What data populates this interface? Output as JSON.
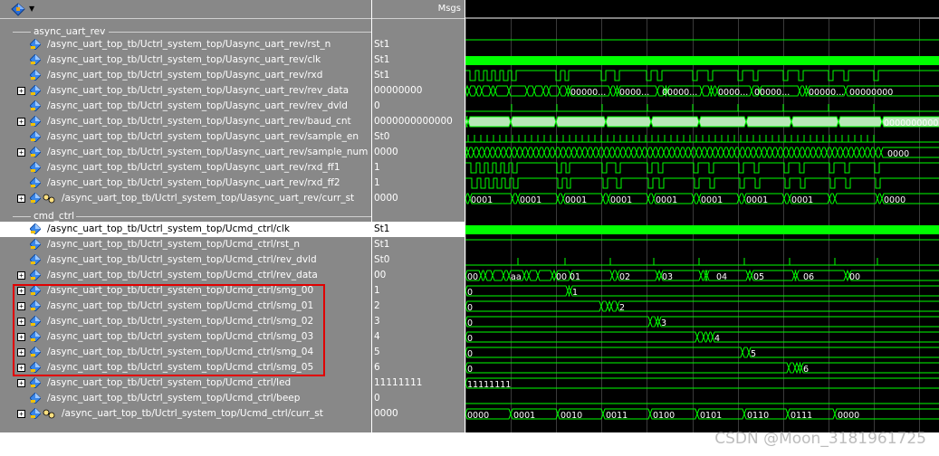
{
  "header": {
    "msgs_label": "Msgs"
  },
  "groups": [
    {
      "label": "async_uart_rev"
    },
    {
      "label": "cmd_ctrl"
    }
  ],
  "signals": [
    {
      "path": "/async_uart_top_tb/Uctrl_system_top/Uasync_uart_rev/rst_n",
      "value": "St1",
      "expand": false,
      "icon": "signal-icon"
    },
    {
      "path": "/async_uart_top_tb/Uctrl_system_top/Uasync_uart_rev/clk",
      "value": "St1",
      "expand": false,
      "icon": "signal-icon"
    },
    {
      "path": "/async_uart_top_tb/Uctrl_system_top/Uasync_uart_rev/rxd",
      "value": "St1",
      "expand": false,
      "icon": "signal-icon"
    },
    {
      "path": "/async_uart_top_tb/Uctrl_system_top/Uasync_uart_rev/rev_data",
      "value": "00000000",
      "expand": true,
      "icon": "signal-icon"
    },
    {
      "path": "/async_uart_top_tb/Uctrl_system_top/Uasync_uart_rev/rev_dvld",
      "value": "0",
      "expand": false,
      "icon": "signal-icon"
    },
    {
      "path": "/async_uart_top_tb/Uctrl_system_top/Uasync_uart_rev/baud_cnt",
      "value": "0000000000000",
      "expand": true,
      "icon": "signal-icon"
    },
    {
      "path": "/async_uart_top_tb/Uctrl_system_top/Uasync_uart_rev/sample_en",
      "value": "St0",
      "expand": false,
      "icon": "signal-icon"
    },
    {
      "path": "/async_uart_top_tb/Uctrl_system_top/Uasync_uart_rev/sample_num",
      "value": "0000",
      "expand": true,
      "icon": "signal-icon"
    },
    {
      "path": "/async_uart_top_tb/Uctrl_system_top/Uasync_uart_rev/rxd_ff1",
      "value": "1",
      "expand": false,
      "icon": "signal-icon"
    },
    {
      "path": "/async_uart_top_tb/Uctrl_system_top/Uasync_uart_rev/rxd_ff2",
      "value": "1",
      "expand": false,
      "icon": "signal-icon"
    },
    {
      "path": "/async_uart_top_tb/Uctrl_system_top/Uasync_uart_rev/curr_st",
      "value": "0000",
      "expand": true,
      "icon": "state-icon"
    },
    {
      "path": "/async_uart_top_tb/Uctrl_system_top/Ucmd_ctrl/clk",
      "value": "St1",
      "expand": false,
      "icon": "signal-icon",
      "selected": true
    },
    {
      "path": "/async_uart_top_tb/Uctrl_system_top/Ucmd_ctrl/rst_n",
      "value": "St1",
      "expand": false,
      "icon": "signal-icon"
    },
    {
      "path": "/async_uart_top_tb/Uctrl_system_top/Ucmd_ctrl/rev_dvld",
      "value": "St0",
      "expand": false,
      "icon": "signal-icon"
    },
    {
      "path": "/async_uart_top_tb/Uctrl_system_top/Ucmd_ctrl/rev_data",
      "value": "00",
      "expand": true,
      "icon": "signal-icon"
    },
    {
      "path": "/async_uart_top_tb/Uctrl_system_top/Ucmd_ctrl/smg_00",
      "value": "1",
      "expand": true,
      "icon": "signal-icon"
    },
    {
      "path": "/async_uart_top_tb/Uctrl_system_top/Ucmd_ctrl/smg_01",
      "value": "2",
      "expand": true,
      "icon": "signal-icon"
    },
    {
      "path": "/async_uart_top_tb/Uctrl_system_top/Ucmd_ctrl/smg_02",
      "value": "3",
      "expand": true,
      "icon": "signal-icon"
    },
    {
      "path": "/async_uart_top_tb/Uctrl_system_top/Ucmd_ctrl/smg_03",
      "value": "4",
      "expand": true,
      "icon": "signal-icon"
    },
    {
      "path": "/async_uart_top_tb/Uctrl_system_top/Ucmd_ctrl/smg_04",
      "value": "5",
      "expand": true,
      "icon": "signal-icon"
    },
    {
      "path": "/async_uart_top_tb/Uctrl_system_top/Ucmd_ctrl/smg_05",
      "value": "6",
      "expand": true,
      "icon": "signal-icon"
    },
    {
      "path": "/async_uart_top_tb/Uctrl_system_top/Ucmd_ctrl/led",
      "value": "11111111",
      "expand": true,
      "icon": "signal-icon"
    },
    {
      "path": "/async_uart_top_tb/Uctrl_system_top/Ucmd_ctrl/beep",
      "value": "0",
      "expand": false,
      "icon": "signal-icon"
    },
    {
      "path": "/async_uart_top_tb/Uctrl_system_top/Ucmd_ctrl/curr_st",
      "value": "0000",
      "expand": true,
      "icon": "state-icon"
    }
  ],
  "wave_labels": {
    "rev_data": [
      "00000...",
      "0000...",
      "00000...",
      "0000...",
      "00000...",
      "00000...",
      "00000000"
    ],
    "baud_cnt": [
      "0000000000000"
    ],
    "sample_num": [
      "0000"
    ],
    "uart_curr_st": [
      "0001",
      "0001",
      "0001",
      "0001",
      "0001",
      "0001",
      "0001",
      "0001",
      "0000"
    ],
    "cmd_rev_data": [
      "00",
      "aa",
      "00",
      "01",
      "02",
      "03",
      "04",
      "05",
      "06",
      "00"
    ],
    "smg_00": [
      "0",
      "1"
    ],
    "smg_01": [
      "0",
      "2"
    ],
    "smg_02": [
      "0",
      "3"
    ],
    "smg_03": [
      "0",
      "4"
    ],
    "smg_04": [
      "0",
      "5"
    ],
    "smg_05": [
      "0",
      "6"
    ],
    "led": [
      "11111111"
    ],
    "cmd_curr_st": [
      "0000",
      "0001",
      "0010",
      "0011",
      "0100",
      "0101",
      "0110",
      "0111",
      "0000"
    ]
  },
  "watermark": "CSDN @Moon_3181961725",
  "colors": {
    "wave": "#00ff00",
    "text": "#ffffff",
    "highlight": "#e00000",
    "panel": "#888888"
  }
}
